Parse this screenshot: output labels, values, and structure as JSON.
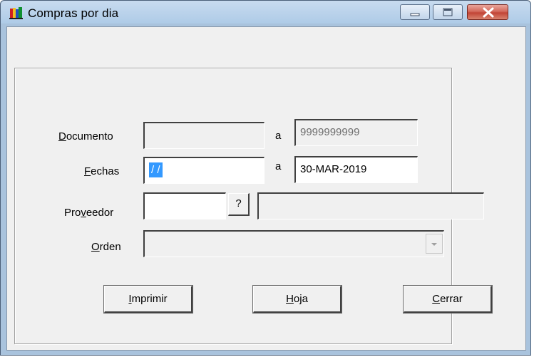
{
  "window": {
    "title": "Compras por dia",
    "app_icon": "books-icon",
    "controls": {
      "minimize": "minimize-icon",
      "maximize": "maximize-icon",
      "close": "close-icon"
    }
  },
  "form": {
    "documento": {
      "label_hot": "D",
      "label_rest": "ocumento",
      "from_value": "",
      "to_label": "a",
      "to_value": "9999999999"
    },
    "fechas": {
      "label_hot": "F",
      "label_rest": "echas",
      "from_value": " /  /",
      "to_label": "a",
      "to_value": "30-MAR-2019"
    },
    "proveedor": {
      "label_pre": "Pro",
      "label_hot": "v",
      "label_post": "eedor",
      "code_value": "",
      "lookup_label": "?",
      "name_value": ""
    },
    "orden": {
      "label_hot": "O",
      "label_rest": "rden",
      "selected": ""
    }
  },
  "buttons": {
    "imprimir": {
      "hot": "I",
      "rest": "mprimir"
    },
    "hoja": {
      "hot": "H",
      "rest": "oja"
    },
    "cerrar": {
      "hot": "C",
      "rest": "errar"
    }
  }
}
